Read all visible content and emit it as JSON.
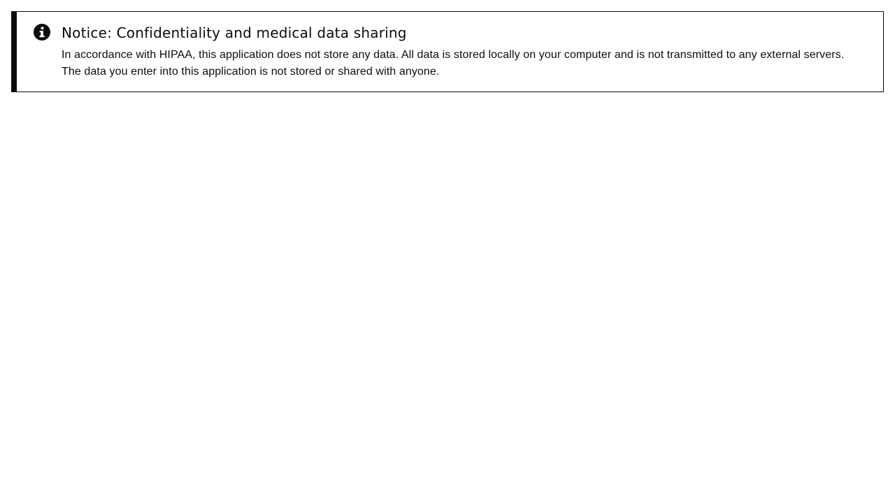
{
  "notice": {
    "icon": "info-icon",
    "title": "Notice: Confidentiality and medical data sharing",
    "body": "In accordance with HIPAA, this application does not store any data. All data is stored locally on your computer and is not transmitted to any external servers. The data you enter into this application is not stored or shared with anyone.",
    "accent_color": "#0b0c0c"
  }
}
